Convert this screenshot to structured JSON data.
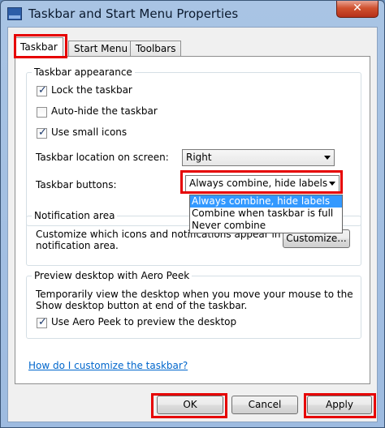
{
  "window": {
    "title": "Taskbar and Start Menu Properties",
    "close_glyph": "✕"
  },
  "tabs": [
    {
      "label": "Taskbar",
      "active": true
    },
    {
      "label": "Start Menu",
      "active": false
    },
    {
      "label": "Toolbars",
      "active": false
    }
  ],
  "taskbar_appearance": {
    "title": "Taskbar appearance",
    "lock_label": "Lock the taskbar",
    "lock_checked": true,
    "autohide_label": "Auto-hide the taskbar",
    "autohide_checked": false,
    "small_icons_label": "Use small icons",
    "small_icons_checked": true,
    "location_label": "Taskbar location on screen:",
    "location_value": "Right",
    "buttons_label": "Taskbar buttons:",
    "buttons_value": "Always combine, hide labels",
    "buttons_options": [
      "Always combine, hide labels",
      "Combine when taskbar is full",
      "Never combine"
    ]
  },
  "notification_area": {
    "title": "Notification area",
    "description_line1": "Customize which icons and notifications appear in the",
    "description_line2": "notification area.",
    "customize_button": "Customize..."
  },
  "aero_peek": {
    "title": "Preview desktop with Aero Peek",
    "description_line1": "Temporarily view the desktop when you move your mouse to the",
    "description_line2": "Show desktop button at end of the taskbar.",
    "checkbox_label": "Use Aero Peek to preview the desktop",
    "checkbox_checked": true
  },
  "help_link": "How do I customize the taskbar?",
  "buttons": {
    "ok": "OK",
    "cancel": "Cancel",
    "apply": "Apply"
  },
  "colors": {
    "highlight": "#e60000",
    "selection": "#3399ff",
    "link": "#0066cc"
  }
}
